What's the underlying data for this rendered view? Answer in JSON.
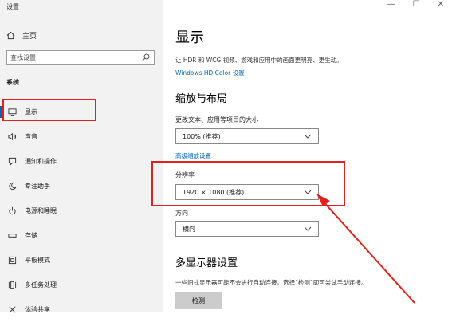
{
  "window": {
    "title": "设置",
    "minimize_glyph": "—",
    "maximize_glyph": "☐",
    "close_glyph": "✕"
  },
  "sidebar": {
    "home_label": "主页",
    "search_placeholder": "查找设置",
    "section_label": "系统",
    "items": [
      {
        "label": "显示",
        "icon": "monitor-icon",
        "active": true
      },
      {
        "label": "声音",
        "icon": "speaker-icon"
      },
      {
        "label": "通知和操作",
        "icon": "notification-icon"
      },
      {
        "label": "专注助手",
        "icon": "moon-icon"
      },
      {
        "label": "电源和睡眠",
        "icon": "power-icon"
      },
      {
        "label": "存储",
        "icon": "storage-icon"
      },
      {
        "label": "平板模式",
        "icon": "tablet-icon"
      },
      {
        "label": "多任务处理",
        "icon": "multitask-icon"
      },
      {
        "label": "体验共享",
        "icon": "share-icon"
      }
    ]
  },
  "main": {
    "title": "显示",
    "hdr_desc": "让 HDR 和 WCG 视频、游戏和应用中的画面更明亮、更生动。",
    "hdr_link": "Windows HD Color 设置",
    "scale_section": "缩放与布局",
    "scale_label": "更改文本、应用等项目的大小",
    "scale_value": "100% (推荐)",
    "advanced_link": "高级缩放设置",
    "resolution_label": "分辨率",
    "resolution_value": "1920 × 1080 (推荐)",
    "orientation_label": "方向",
    "orientation_value": "横向",
    "multi_section": "多显示器设置",
    "multi_desc": "一些旧式显示器可能不会进行自动连接。选择“检测”即可尝试手动连接。",
    "detect_button": "检测"
  },
  "colors": {
    "accent": "#0067b8",
    "highlight": "#e0211c",
    "sidebar_bg": "#f2f2f2"
  }
}
